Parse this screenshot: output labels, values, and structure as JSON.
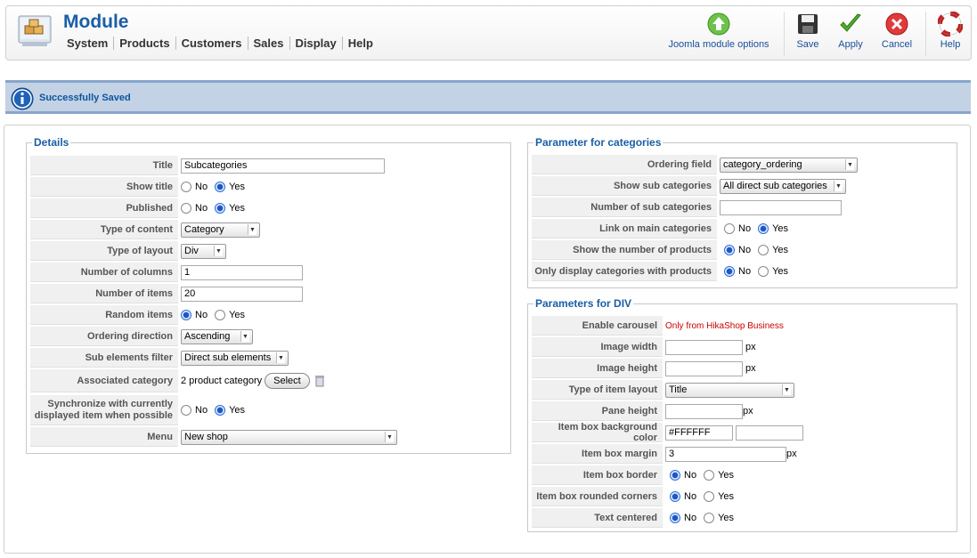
{
  "header": {
    "title": "Module",
    "menu": [
      "System",
      "Products",
      "Customers",
      "Sales",
      "Display",
      "Help"
    ],
    "toolbar": {
      "joomla_label": "Joomla module options",
      "save_label": "Save",
      "apply_label": "Apply",
      "cancel_label": "Cancel",
      "help_label": "Help"
    }
  },
  "message": {
    "text": "Successfully Saved"
  },
  "details": {
    "legend": "Details",
    "title_label": "Title",
    "title_value": "Subcategories",
    "show_title_label": "Show title",
    "published_label": "Published",
    "type_content_label": "Type of content",
    "type_content_value": "Category",
    "type_layout_label": "Type of layout",
    "type_layout_value": "Div",
    "columns_label": "Number of columns",
    "columns_value": "1",
    "items_label": "Number of items",
    "items_value": "20",
    "random_label": "Random items",
    "ordering_dir_label": "Ordering direction",
    "ordering_dir_value": "Ascending",
    "sub_filter_label": "Sub elements filter",
    "sub_filter_value": "Direct sub elements",
    "assoc_label": "Associated category",
    "assoc_value": "2 product category",
    "select_label": "Select",
    "sync_label_1": "Synchronize with currently",
    "sync_label_2": "displayed item when possible",
    "menu_label": "Menu",
    "menu_value": "New shop"
  },
  "categories": {
    "legend": "Parameter for categories",
    "ordering_field_label": "Ordering field",
    "ordering_field_value": "category_ordering",
    "show_sub_label": "Show sub categories",
    "show_sub_value": "All direct sub categories",
    "num_sub_label": "Number of sub categories",
    "link_main_label": "Link on main categories",
    "show_num_label": "Show the number of products",
    "only_display_label": "Only display categories with products"
  },
  "div": {
    "legend": "Parameters for DIV",
    "carousel_label": "Enable carousel",
    "carousel_note": "Only from HikaShop Business",
    "img_width_label": "Image width",
    "img_height_label": "Image height",
    "item_layout_label": "Type of item layout",
    "item_layout_value": "Title",
    "pane_height_label": "Pane height",
    "bg_color_label": "Item box background color",
    "bg_color_value": "#FFFFFF",
    "margin_label": "Item box margin",
    "margin_value": "3",
    "border_label": "Item box border",
    "rounded_label": "Item box rounded corners",
    "centered_label": "Text centered",
    "px_unit": "px"
  },
  "options": {
    "no": "No",
    "yes": "Yes"
  }
}
